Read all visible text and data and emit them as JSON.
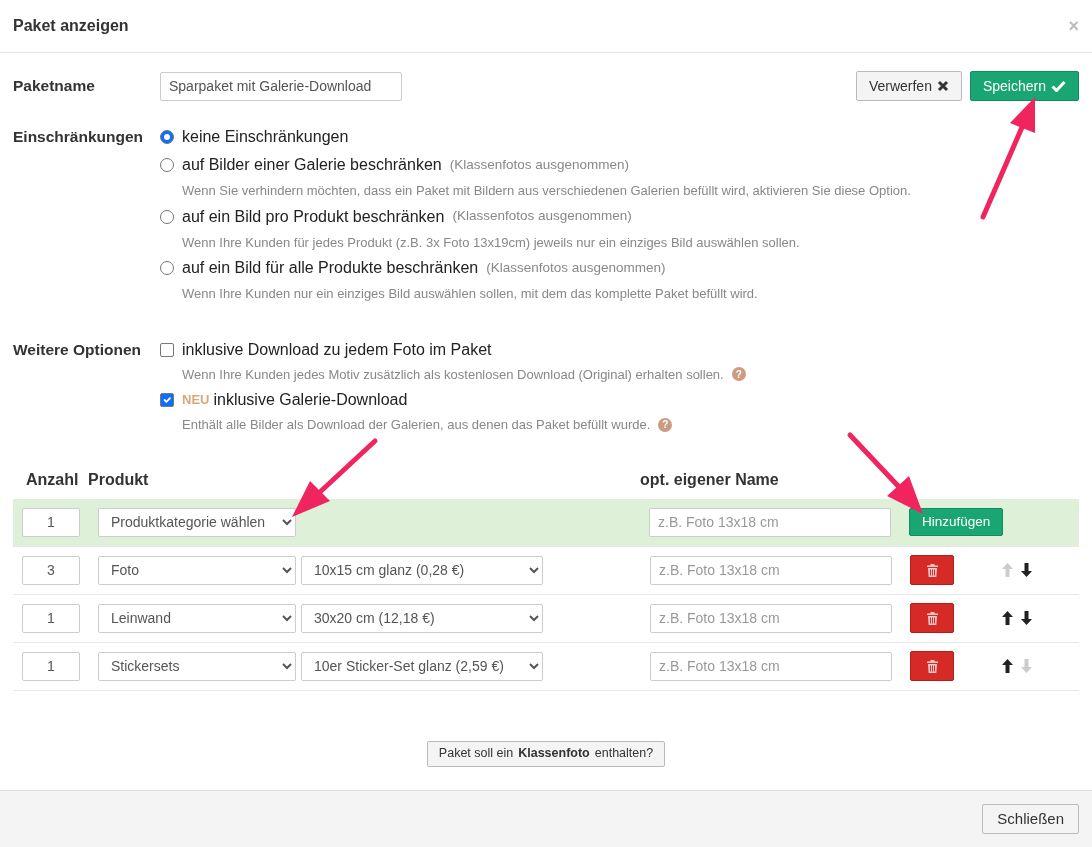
{
  "dialog": {
    "title": "Paket anzeigen",
    "close_icon": "×"
  },
  "package_name": {
    "label": "Paketname",
    "value": "Sparpaket mit Galerie-Download"
  },
  "actions": [
    {
      "label": "Verwerfen",
      "kind": "discard"
    },
    {
      "label": "Speichern",
      "kind": "save"
    }
  ],
  "restrictions": {
    "label": "Einschränkungen",
    "options": [
      {
        "label": "keine Einschränkungen",
        "selected": true
      },
      {
        "label": "auf Bilder einer Galerie beschränken",
        "note": "(Klassenfotos ausgenommen)",
        "hint": "Wenn Sie verhindern möchten, dass ein Paket mit Bildern aus verschiedenen Galerien befüllt wird, aktivieren Sie diese Option.",
        "selected": false
      },
      {
        "label": "auf ein Bild pro Produkt beschränken",
        "note": "(Klassenfotos ausgenommen)",
        "hint": "Wenn Ihre Kunden für jedes Produkt (z.B. 3x Foto 13x19cm) jeweils nur ein einziges Bild auswählen sollen.",
        "selected": false
      },
      {
        "label": "auf ein Bild für alle Produkte beschränken",
        "note": "(Klassenfotos ausgenommen)",
        "hint": "Wenn Ihre Kunden nur ein einziges Bild auswählen sollen, mit dem das komplette Paket befüllt wird.",
        "selected": false
      }
    ]
  },
  "more_options": {
    "label": "Weitere Optionen",
    "options": [
      {
        "label": "inklusive Download zu jedem Foto im Paket",
        "hint": "Wenn Ihre Kunden jedes Motiv zusätzlich als kostenlosen Download (Original) erhalten sollen.",
        "help": "?",
        "checked": false
      },
      {
        "label": "inklusive Galerie-Download",
        "badge": "NEU",
        "hint": "Enthält alle Bilder als Download der Galerien, aus denen das Paket befüllt wurde.",
        "help": "?",
        "checked": true
      }
    ]
  },
  "table": {
    "columns": [
      "Anzahl",
      "Produkt",
      "opt. eigener Name"
    ],
    "new_row": {
      "quantity": "1",
      "category": "Produktkategorie wählen",
      "name_placeholder": "z.B. Foto 13x18 cm",
      "add_button": "Hinzufügen"
    },
    "rows": [
      {
        "quantity": "3",
        "product": "Foto",
        "variant": "10x15 cm glanz (0,28 €)",
        "name_placeholder": "z.B. Foto 13x18 cm",
        "up_disabled": true,
        "down_disabled": false
      },
      {
        "quantity": "1",
        "product": "Leinwand",
        "variant": "30x20 cm (12,18 €)",
        "name_placeholder": "z.B. Foto 13x18 cm",
        "up_disabled": false,
        "down_disabled": false
      },
      {
        "quantity": "1",
        "product": "Stickersets",
        "variant": "10er Sticker-Set glanz (2,59 €)",
        "name_placeholder": "z.B. Foto 13x18 cm",
        "up_disabled": false,
        "down_disabled": true
      }
    ]
  },
  "class_photo_button": "Paket soll ein **Klassenfoto** enthalten?",
  "footer": {
    "close_button": "Schließen"
  }
}
